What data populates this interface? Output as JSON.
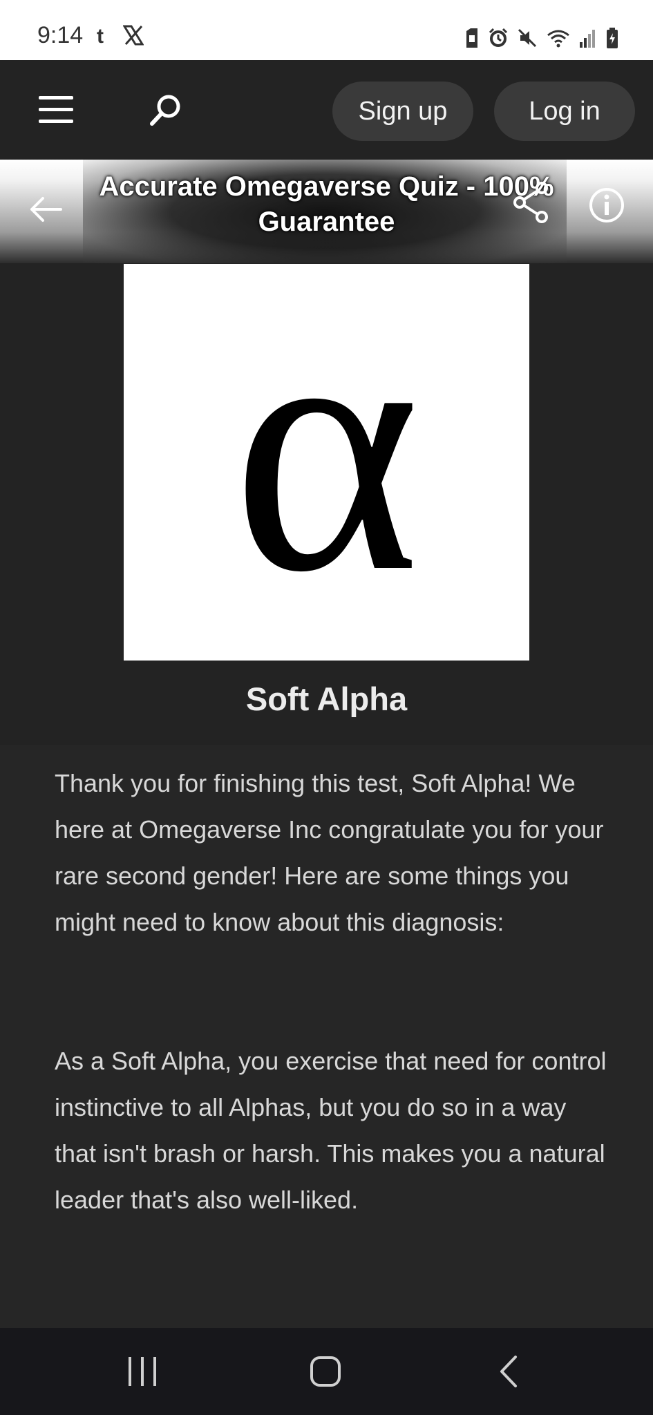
{
  "status_bar": {
    "time": "9:14",
    "left_icons": [
      "tumblr-icon",
      "x-icon"
    ],
    "right_icons": [
      "sim-icon",
      "alarm-icon",
      "mute-icon",
      "wifi-icon",
      "signal-icon",
      "battery-icon"
    ]
  },
  "nav": {
    "signup_label": "Sign up",
    "login_label": "Log in"
  },
  "quiz": {
    "title": "Accurate Omegaverse Quiz - 100% Guarantee"
  },
  "result": {
    "image_symbol": "α",
    "title": "Soft Alpha",
    "paragraphs": [
      "Thank you for finishing this test, Soft Alpha! We here at Omegaverse Inc congratulate you for your rare second gender! Here are some things you might need to know about this diagnosis:",
      "As a Soft Alpha, you exercise that need for control instinctive to all Alphas, but you do so in a way that isn't brash or harsh. This makes you a natural leader that's also well-liked."
    ]
  },
  "colors": {
    "background": "#232323",
    "pill": "#3a3a3a",
    "text": "#d8d8d8",
    "bottom_nav": "#17171b"
  }
}
